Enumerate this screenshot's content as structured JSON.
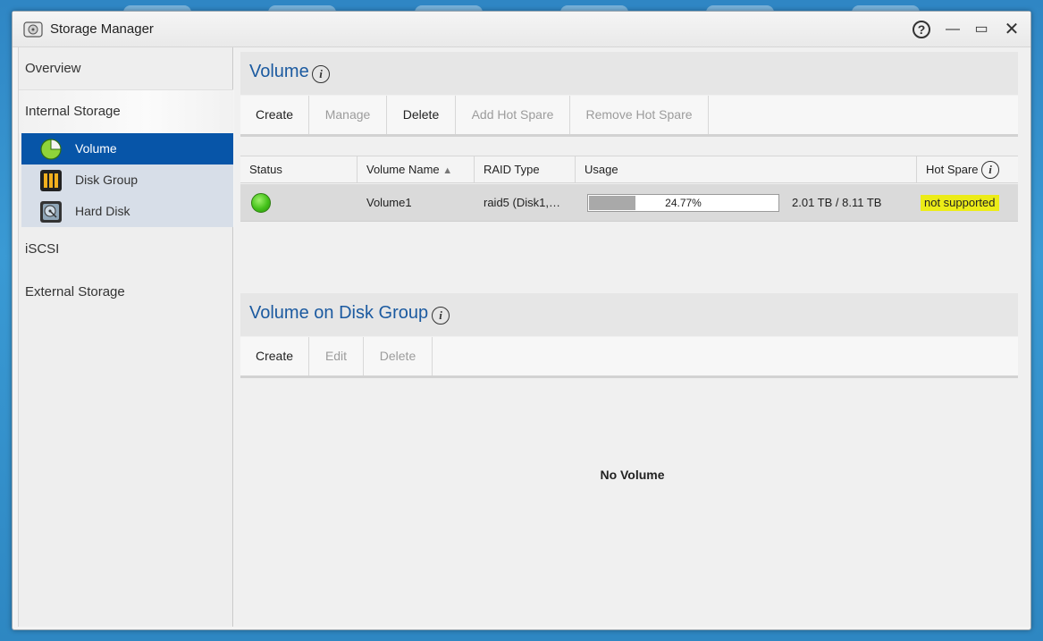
{
  "window": {
    "title": "Storage Manager",
    "help_glyph": "?",
    "minimize_glyph": "—",
    "maximize_glyph": "▭",
    "close_glyph": "✕"
  },
  "sidebar": {
    "overview": "Overview",
    "internal_storage": "Internal Storage",
    "sub_items": [
      {
        "label": "Volume",
        "icon": "volume-pie-icon",
        "active": true
      },
      {
        "label": "Disk Group",
        "icon": "disk-group-icon"
      },
      {
        "label": "Hard Disk",
        "icon": "hard-disk-icon"
      }
    ],
    "iscsi": "iSCSI",
    "external_storage": "External Storage"
  },
  "volume_section": {
    "title": "Volume",
    "toolbar": {
      "create": "Create",
      "manage": "Manage",
      "delete": "Delete",
      "add_hot_spare": "Add Hot Spare",
      "remove_hot_spare": "Remove Hot Spare"
    },
    "table": {
      "columns": {
        "status": "Status",
        "volume_name": "Volume Name",
        "sort_glyph": "▲",
        "raid_type": "RAID Type",
        "usage": "Usage",
        "hot_spare": "Hot Spare"
      },
      "rows": [
        {
          "status": "green",
          "volume_name": "Volume1",
          "raid_type": "raid5 (Disk1,…",
          "usage_fraction": 0.2477,
          "usage_percent": "24.77%",
          "capacity": "2.01 TB / 8.11 TB",
          "hot_spare": "not supported"
        }
      ]
    }
  },
  "disk_group_section": {
    "title": "Volume on Disk Group",
    "toolbar": {
      "create": "Create",
      "edit": "Edit",
      "delete": "Delete"
    },
    "empty_text": "No Volume"
  },
  "info_glyph": "i",
  "colors": {
    "accent": "#0755a8",
    "title_blue": "#1b5aa0",
    "status_green": "#44c21a",
    "highlight": "#ecec17"
  }
}
